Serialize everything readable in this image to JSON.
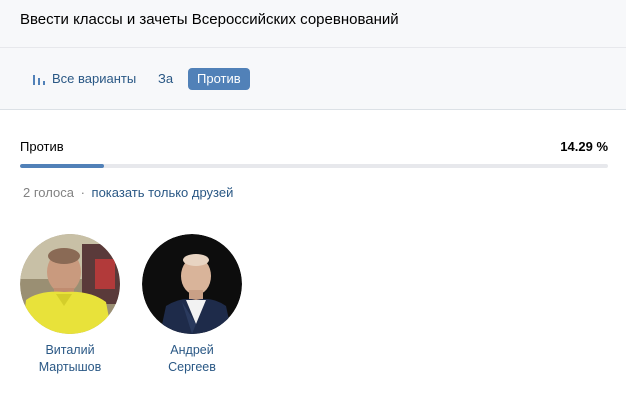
{
  "poll": {
    "title": "Ввести классы и зачеты Всероссийских соревнований"
  },
  "tabs": [
    {
      "label": "Все варианты",
      "icon": "bar-chart-icon",
      "active": false
    },
    {
      "label": "За",
      "active": false
    },
    {
      "label": "Против",
      "active": true
    }
  ],
  "result": {
    "label": "Против",
    "percent_text": "14.29 %",
    "fraction": 0.1429
  },
  "votes": {
    "count_text": "2 голоса",
    "separator": "·",
    "friends_link": "показать только друзей"
  },
  "voters": [
    {
      "first_name": "Виталий",
      "last_name": "Мартышов"
    },
    {
      "first_name": "Андрей",
      "last_name": "Сергеев"
    }
  ],
  "colors": {
    "accent": "#5181b8",
    "link": "#2a5885",
    "muted": "#828282"
  }
}
